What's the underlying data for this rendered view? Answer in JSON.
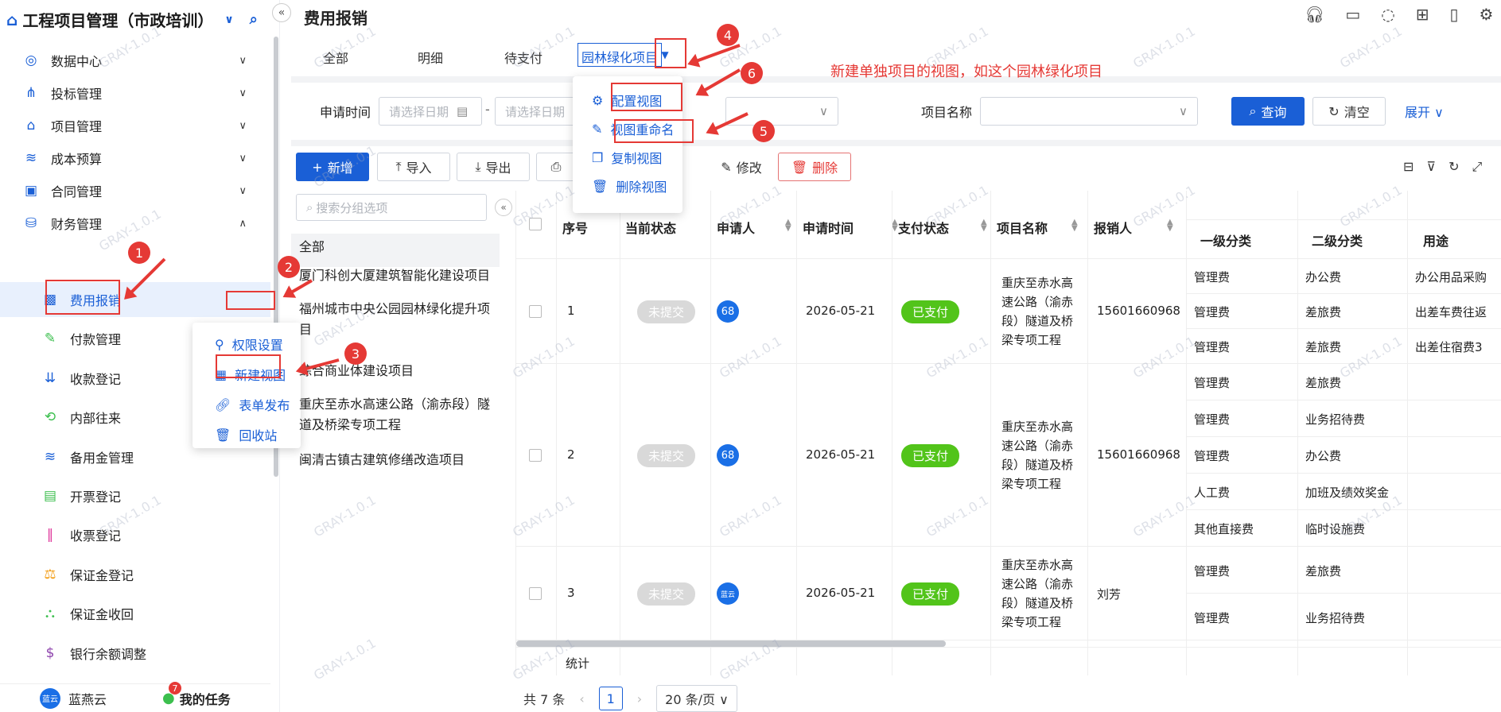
{
  "sidebar": {
    "title": "工程项目管理（市政培训）",
    "menu": [
      {
        "label": "数据中心",
        "icon": "dashboard-icon"
      },
      {
        "label": "投标管理",
        "icon": "bid-icon"
      },
      {
        "label": "项目管理",
        "icon": "project-icon"
      },
      {
        "label": "成本预算",
        "icon": "budget-icon"
      },
      {
        "label": "合同管理",
        "icon": "contract-icon"
      },
      {
        "label": "财务管理",
        "icon": "finance-icon"
      }
    ],
    "sub": [
      {
        "label": "费用报销"
      },
      {
        "label": "付款管理"
      },
      {
        "label": "收款登记"
      },
      {
        "label": "内部往来"
      },
      {
        "label": "备用金管理"
      },
      {
        "label": "开票登记"
      },
      {
        "label": "收票登记"
      },
      {
        "label": "保证金登记"
      },
      {
        "label": "保证金收回"
      },
      {
        "label": "银行余额调整"
      }
    ],
    "more_label": "···",
    "footer": {
      "user": "蓝燕云",
      "tasks": "我的任务",
      "task_count": "7"
    }
  },
  "context_menu": [
    "权限设置",
    "新建视图",
    "表单发布",
    "回收站"
  ],
  "header": {
    "title": "费用报销"
  },
  "tabs": [
    "全部",
    "明细",
    "待支付",
    "园林绿化项目"
  ],
  "view_menu": [
    "配置视图",
    "视图重命名",
    "复制视图",
    "删除视图"
  ],
  "annotation_text": "新建单独项目的视图，如这个园林绿化项目",
  "filters": {
    "date_label": "申请时间",
    "date_placeholder": "请选择日期",
    "date_sep": "-",
    "project_label": "项目名称",
    "search_btn": "查询",
    "clear_btn": "清空",
    "expand_btn": "展开"
  },
  "toolbar": {
    "add": "新增",
    "import": "导入",
    "export": "导出",
    "edit": "修改",
    "delete": "删除"
  },
  "group_panel": {
    "search_placeholder": "搜索分组选项",
    "items": [
      "全部",
      "厦门科创大厦建筑智能化建设项目",
      "福州城市中央公园园林绿化提升项目",
      "综合商业体建设项目",
      "重庆至赤水高速公路（渝赤段）隧道及桥梁专项工程",
      "闽清古镇古建筑修缮改造项目"
    ]
  },
  "table": {
    "headers": [
      "序号",
      "当前状态",
      "申请人",
      "申请时间",
      "支付状态",
      "项目名称",
      "报销人",
      "一级分类",
      "二级分类",
      "用途"
    ],
    "rows": [
      {
        "no": "1",
        "status": "未提交",
        "applicant": "68",
        "date": "2026-05-21",
        "pay": "已支付",
        "project": "重庆至赤水高速公路（渝赤段）隧道及桥梁专项工程",
        "reimburser": "15601660968",
        "details": [
          [
            "管理费",
            "办公费",
            "办公用品采购"
          ],
          [
            "管理费",
            "差旅费",
            "出差车费往返"
          ],
          [
            "管理费",
            "差旅费",
            "出差住宿费3"
          ]
        ]
      },
      {
        "no": "2",
        "status": "未提交",
        "applicant": "68",
        "date": "2026-05-21",
        "pay": "已支付",
        "project": "重庆至赤水高速公路（渝赤段）隧道及桥梁专项工程",
        "reimburser": "15601660968",
        "details": [
          [
            "管理费",
            "差旅费",
            ""
          ],
          [
            "管理费",
            "业务招待费",
            ""
          ],
          [
            "管理费",
            "办公费",
            ""
          ],
          [
            "人工费",
            "加班及绩效奖金",
            ""
          ],
          [
            "其他直接费",
            "临时设施费",
            ""
          ]
        ]
      },
      {
        "no": "3",
        "status": "未提交",
        "applicant": "蓝云",
        "date": "2026-05-21",
        "pay": "已支付",
        "project": "重庆至赤水高速公路（渝赤段）隧道及桥梁专项工程",
        "reimburser": "刘芳",
        "details": [
          [
            "管理费",
            "差旅费",
            ""
          ],
          [
            "管理费",
            "业务招待费",
            ""
          ]
        ]
      }
    ],
    "summary": "统计"
  },
  "pagination": {
    "total": "共 7 条",
    "page": "1",
    "size": "20 条/页"
  },
  "watermark": "GRAY-1.0.1",
  "markers": [
    "1",
    "2",
    "3",
    "4",
    "5",
    "6"
  ]
}
